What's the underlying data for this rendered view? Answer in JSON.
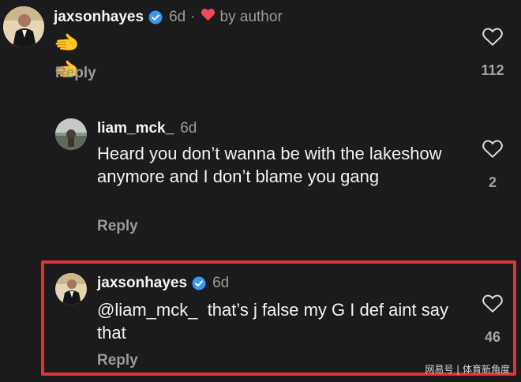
{
  "comments": [
    {
      "username": "jaxsonhayes",
      "time": "6d",
      "separator": "·",
      "liked_by_author_text": "by author",
      "text": "🫲🫲",
      "reply_label": "Reply",
      "like_count": "112",
      "verified": true
    },
    {
      "username": "liam_mck_",
      "time": "6d",
      "text": "Heard you don’t wanna be with the lakeshow anymore and I don’t blame you gang",
      "reply_label": "Reply",
      "like_count": "2",
      "verified": false
    },
    {
      "username": "jaxsonhayes",
      "time": "6d",
      "text": "@liam_mck_  that’s j false my G I def aint say that",
      "reply_label": "Reply",
      "like_count": "46",
      "verified": true
    }
  ],
  "watermark": "网易号 | 体育新角度",
  "colors": {
    "background": "#1b1b1d",
    "verified_blue": "#3897f0",
    "author_heart": "#ed4956",
    "highlight": "#e03434",
    "secondary_text": "#9a9a9a"
  },
  "icons": {
    "like": "heart-outline-icon",
    "verified": "verified-badge-icon",
    "author_like": "heart-filled-icon"
  }
}
